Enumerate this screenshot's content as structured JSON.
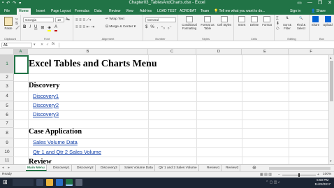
{
  "window": {
    "title": "Chapter03_TablesAndCharts.xlsx - Excel",
    "user_initial": "W",
    "minimize": "—",
    "restore": "❐",
    "close": "✕"
  },
  "ribbon_tabs": [
    {
      "label": "File"
    },
    {
      "label": "Home"
    },
    {
      "label": "Insert"
    },
    {
      "label": "Page Layout"
    },
    {
      "label": "Formulas"
    },
    {
      "label": "Data"
    },
    {
      "label": "Review"
    },
    {
      "label": "View"
    },
    {
      "label": "Add-ins"
    },
    {
      "label": "LOAD TEST"
    },
    {
      "label": "ACROBAT"
    },
    {
      "label": "Team"
    },
    {
      "label": "Tell me what you want to do..."
    },
    {
      "label": "Sign in"
    },
    {
      "label": "Share"
    }
  ],
  "ribbon": {
    "paste": "Paste",
    "font_name": "Georgia",
    "font_size": "18",
    "bold": "B",
    "italic": "I",
    "underline": "U",
    "font_a": "A",
    "wrap_text": "Wrap Text",
    "merge_center": "Merge & Center",
    "number_format": "General",
    "pct": "%",
    "comma": ",",
    "dollar": "$",
    "conditional": "Conditional Formatting",
    "format_table": "Format as Table",
    "cell_styles": "Cell Styles",
    "insert": "Insert",
    "delete": "Delete",
    "format": "Format",
    "sort_filter": "Sort & Filter",
    "find_select": "Find & Select",
    "share": "Share",
    "upload": "Upload",
    "groups": {
      "clipboard": "Clipboard",
      "font": "Font",
      "alignment": "Alignment",
      "number": "Number",
      "styles": "Styles",
      "cells": "Cells",
      "editing": "Editing",
      "box": "Box"
    }
  },
  "formula_bar": {
    "name_box": "A1",
    "fx": "fx",
    "value": ""
  },
  "columns": [
    "A",
    "B",
    "C",
    "D",
    "E",
    "F"
  ],
  "rows": [
    "1",
    "2",
    "3",
    "4",
    "5",
    "6",
    "7",
    "8",
    "9",
    "10",
    "11"
  ],
  "cells": {
    "title": "Excel Tables and Charts Menu",
    "discovery_heading": "Discovery",
    "discovery1": "Discovery1",
    "discovery2": "Discovery2",
    "discovery3": "Discovery3",
    "case_heading": "Case Application",
    "sales_volume": "Sales Volume Data",
    "qtr": "Qtr 1 and Qtr 2 Sales Volume",
    "review_heading": "Review"
  },
  "sheet_tabs": [
    "Main Menu",
    "Discovery1",
    "Discovery2",
    "Discovery3",
    "Sales Volume Data",
    "Qtr 1 and 2 Sales Volume",
    "Review1",
    "Review2"
  ],
  "status": {
    "ready": "Ready",
    "zoom": "100%"
  },
  "taskbar": {
    "time": "5:50 PM",
    "date": "11/22/2017"
  }
}
